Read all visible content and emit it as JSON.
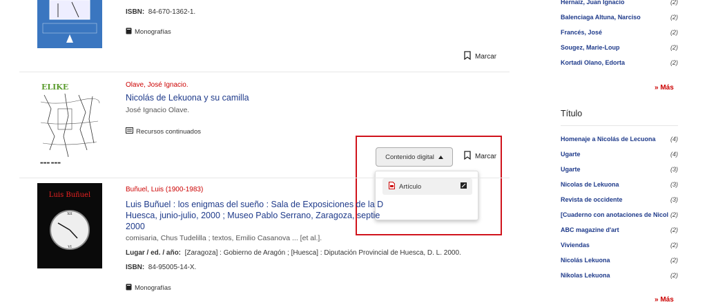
{
  "results": [
    {
      "isbn_label": "ISBN:",
      "isbn": "84-670-1362-1.",
      "type": "Monografías",
      "marcar": "Marcar"
    },
    {
      "author": "Olave, José Ignacio.",
      "title": "Nicolás de Lekuona y su camilla",
      "resp": "José Ignacio Olave.",
      "type": "Recursos continuados",
      "marcar": "Marcar",
      "dropdown_label": "Contenido digital",
      "dropdown_item": "Artículo"
    },
    {
      "author": "Buñuel, Luis (1900-1983)",
      "title_line1": "Luis Buñuel : los enigmas del sueño : Sala de Exposiciones de la D",
      "title_line2": "Huesca, junio-julio, 2000 ; Museo Pablo Serrano, Zaragoza, septie",
      "title_line3": "2000",
      "resp": "comisaria, Chus Tudelilla ; textos, Emilio Casanova ... [et al.].",
      "place_label": "Lugar / ed. / año:",
      "place": "[Zaragoza] : Gobierno de Aragón ; [Huesca] : Diputación Provincial de Huesca, D. L. 2000.",
      "isbn_label": "ISBN:",
      "isbn": "84-95005-14-X.",
      "type": "Monografías",
      "cover_text": "Luis Buñuel"
    }
  ],
  "sidebar": {
    "authors": [
      {
        "name": "Hernaiz, Juan Ignacio",
        "count": "(2)"
      },
      {
        "name": "Balenciaga Altuna, Narciso",
        "count": "(2)"
      },
      {
        "name": "Francés, José",
        "count": "(2)"
      },
      {
        "name": "Sougez, Marie-Loup",
        "count": "(2)"
      },
      {
        "name": "Kortadi Olano, Edorta",
        "count": "(2)"
      }
    ],
    "mas": "» Más",
    "titulo_heading": "Título",
    "titles": [
      {
        "name": "Homenaje a Nicolás de Lecuona",
        "count": "(4)"
      },
      {
        "name": "Ugarte",
        "count": "(4)"
      },
      {
        "name": "Ugarte",
        "count": "(3)"
      },
      {
        "name": "Nicolas de Lekuona",
        "count": "(3)"
      },
      {
        "name": "Revista de occidente",
        "count": "(3)"
      },
      {
        "name": "[Cuaderno con anotaciones de Nicol",
        "count": "(2)"
      },
      {
        "name": "ABC magazine d'art",
        "count": "(2)"
      },
      {
        "name": "Viviendas",
        "count": "(2)"
      },
      {
        "name": "Nicolás Lekuona",
        "count": "(2)"
      },
      {
        "name": "Nikolas Lekuona",
        "count": "(2)"
      }
    ],
    "mas2": "» Más"
  },
  "colors": {
    "accent_red": "#c00",
    "link_blue": "#1e3a8a",
    "highlight": "#d0121b"
  }
}
